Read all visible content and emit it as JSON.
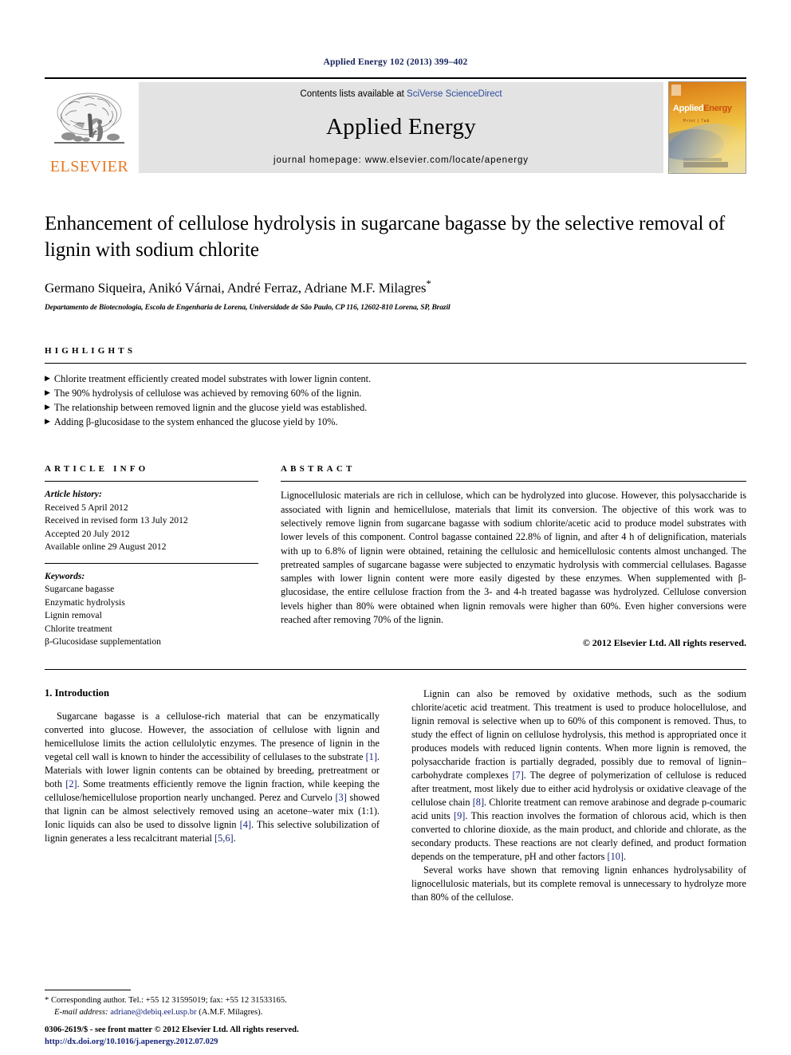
{
  "running_head": "Applied Energy 102 (2013) 399–402",
  "masthead": {
    "publisher": "ELSEVIER",
    "contents_prefix": "Contents lists available at ",
    "contents_link": "SciVerse ScienceDirect",
    "journal_name": "Applied Energy",
    "homepage": "journal homepage: www.elsevier.com/locate/apenergy",
    "cover_title_a": "Applied",
    "cover_title_b": "Energy",
    "cover_sub": "Print | Tab"
  },
  "article": {
    "title": "Enhancement of cellulose hydrolysis in sugarcane bagasse by the selective removal of lignin with sodium chlorite",
    "authors": "Germano Siqueira, Anikó Várnai, André Ferraz, Adriane M.F. Milagres",
    "author_star": "*",
    "affiliation": "Departamento de Biotecnologia, Escola de Engenharia de Lorena, Universidade de São Paulo, CP 116, 12602-810 Lorena, SP, Brazil"
  },
  "highlights": {
    "heading": "HIGHLIGHTS",
    "bullet_glyph": "▶",
    "items": [
      "Chlorite treatment efficiently created model substrates with lower lignin content.",
      "The 90% hydrolysis of cellulose was achieved by removing 60% of the lignin.",
      "The relationship between removed lignin and the glucose yield was established.",
      "Adding β-glucosidase to the system enhanced the glucose yield by 10%."
    ]
  },
  "article_info": {
    "heading": "ARTICLE INFO",
    "history_label": "Article history:",
    "history": [
      "Received 5 April 2012",
      "Received in revised form 13 July 2012",
      "Accepted 20 July 2012",
      "Available online 29 August 2012"
    ],
    "keywords_label": "Keywords:",
    "keywords": [
      "Sugarcane bagasse",
      "Enzymatic hydrolysis",
      "Lignin removal",
      "Chlorite treatment",
      "β-Glucosidase supplementation"
    ]
  },
  "abstract": {
    "heading": "ABSTRACT",
    "text": "Lignocellulosic materials are rich in cellulose, which can be hydrolyzed into glucose. However, this polysaccharide is associated with lignin and hemicellulose, materials that limit its conversion. The objective of this work was to selectively remove lignin from sugarcane bagasse with sodium chlorite/acetic acid to produce model substrates with lower levels of this component. Control bagasse contained 22.8% of lignin, and after 4 h of delignification, materials with up to 6.8% of lignin were obtained, retaining the cellulosic and hemicellulosic contents almost unchanged. The pretreated samples of sugarcane bagasse were subjected to enzymatic hydrolysis with commercial cellulases. Bagasse samples with lower lignin content were more easily digested by these enzymes. When supplemented with β-glucosidase, the entire cellulose fraction from the 3- and 4-h treated bagasse was hydrolyzed. Cellulose conversion levels higher than 80% were obtained when lignin removals were higher than 60%. Even higher conversions were reached after removing 70% of the lignin.",
    "copyright": "© 2012 Elsevier Ltd. All rights reserved."
  },
  "introduction": {
    "heading": "1. Introduction",
    "left_paragraph": "Sugarcane bagasse is a cellulose-rich material that can be enzymatically converted into glucose. However, the association of cellulose with lignin and hemicellulose limits the action cellulolytic enzymes. The presence of lignin in the vegetal cell wall is known to hinder the accessibility of cellulases to the substrate [1]. Materials with lower lignin contents can be obtained by breeding, pretreatment or both [2]. Some treatments efficiently remove the lignin fraction, while keeping the cellulose/hemicellulose proportion nearly unchanged. Perez and Curvelo [3] showed that lignin can be almost selectively removed using an acetone–water mix (1:1). Ionic liquids can also be used to dissolve lignin [4]. This selective solubilization of lignin generates a less recalcitrant material [5,6].",
    "right_paragraph_1": "Lignin can also be removed by oxidative methods, such as the sodium chlorite/acetic acid treatment. This treatment is used to produce holocellulose, and lignin removal is selective when up to 60% of this component is removed. Thus, to study the effect of lignin on cellulose hydrolysis, this method is appropriated once it produces models with reduced lignin contents. When more lignin is removed, the polysaccharide fraction is partially degraded, possibly due to removal of lignin–carbohydrate complexes [7]. The degree of polymerization of cellulose is reduced after treatment, most likely due to either acid hydrolysis or oxidative cleavage of the cellulose chain [8]. Chlorite treatment can remove arabinose and degrade p-coumaric acid units [9]. This reaction involves the formation of chlorous acid, which is then converted to chlorine dioxide, as the main product, and chloride and chlorate, as the secondary products. These reactions are not clearly defined, and product formation depends on the temperature, pH and other factors [10].",
    "right_paragraph_2": "Several works have shown that removing lignin enhances hydrolysability of lignocellulosic materials, but its complete removal is unnecessary to hydrolyze more than 80% of the cellulose."
  },
  "footnotes": {
    "corresponding_marker": "*",
    "corresponding_text": "Corresponding author. Tel.: +55 12 31595019; fax: +55 12 31533165.",
    "email_label": "E-mail address:",
    "email": "adriane@debiq.eel.usp.br",
    "email_owner": "(A.M.F. Milagres).",
    "issn_line": "0306-2619/$ - see front matter © 2012 Elsevier Ltd. All rights reserved.",
    "doi": "http://dx.doi.org/10.1016/j.apenergy.2012.07.029"
  },
  "colors": {
    "elsevier_orange": "#e87722",
    "link_blue": "#2b4a9b",
    "reference_blue": "#16237a",
    "running_head": "#16235a",
    "banner_gray": "#e3e3e3"
  }
}
